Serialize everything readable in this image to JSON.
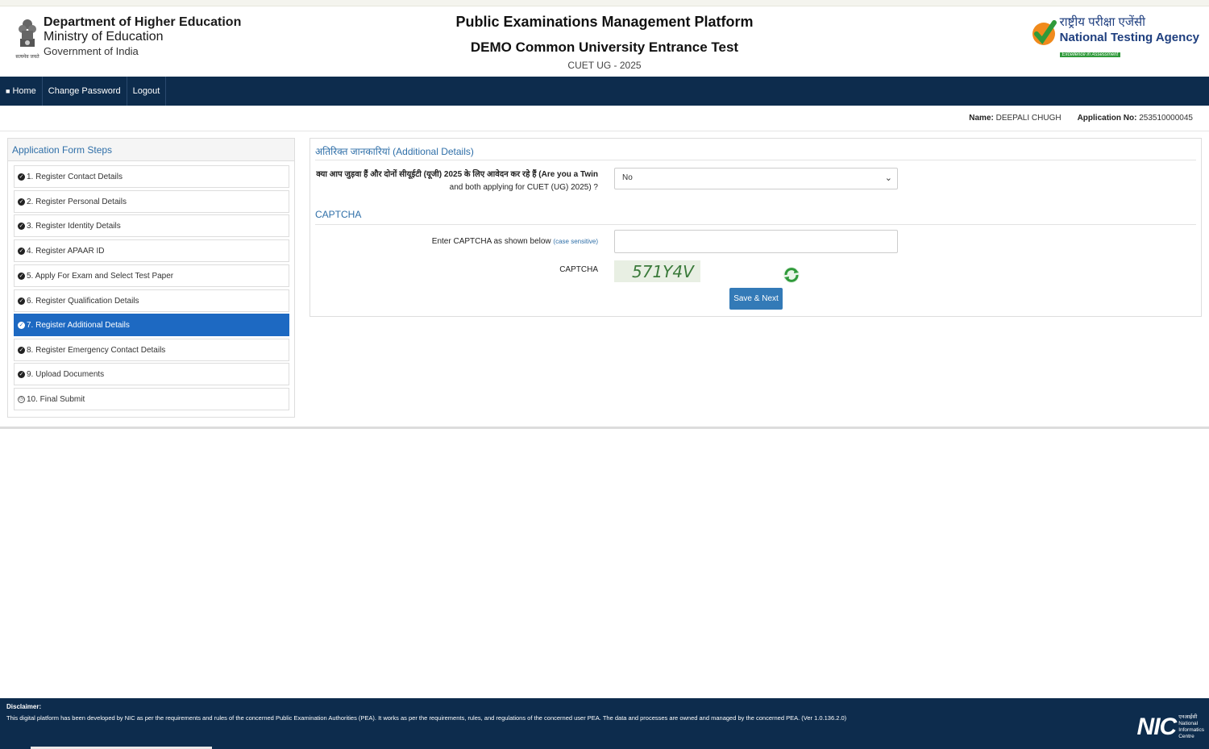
{
  "header": {
    "dept_line1": "Department of Higher Education",
    "dept_line2": "Ministry of Education",
    "dept_line3": "Government of India",
    "emblem_text": "सत्यमेव जयते",
    "title": "Public Examinations Management Platform",
    "subtitle": "DEMO Common University Entrance Test",
    "exam": "CUET UG - 2025",
    "nta_hindi": "राष्ट्रीय परीक्षा एजेंसी",
    "nta_english": "National Testing Agency",
    "nta_tagline": "Excellence in Assessment"
  },
  "nav": {
    "home": "Home",
    "change_password": "Change Password",
    "logout": "Logout"
  },
  "user": {
    "name_label": "Name:",
    "name_value": "DEEPALI CHUGH",
    "app_label": "Application No:",
    "app_value": "253510000045"
  },
  "steps": {
    "title": "Application Form Steps",
    "items": [
      {
        "label": "1. Register Contact Details",
        "status": "done"
      },
      {
        "label": "2. Register Personal Details",
        "status": "done"
      },
      {
        "label": "3. Register Identity Details",
        "status": "done"
      },
      {
        "label": "4. Register APAAR ID",
        "status": "done"
      },
      {
        "label": "5. Apply For Exam and Select Test Paper",
        "status": "done"
      },
      {
        "label": "6. Register Qualification Details",
        "status": "done"
      },
      {
        "label": "7. Register Additional Details",
        "status": "active"
      },
      {
        "label": "8. Register Emergency Contact Details",
        "status": "done"
      },
      {
        "label": "9. Upload Documents",
        "status": "done"
      },
      {
        "label": "10. Final Submit",
        "status": "pending"
      }
    ]
  },
  "form": {
    "section_title": "अतिरिक्त जानकारियां (Additional Details)",
    "twin_question_line1": "क्या आप जुड़वा हैं और दोनों सीयूईटी (यूजी) 2025 के लिए आवेदन कर रहे हैं (Are you a Twin",
    "twin_question_line2": "and both applying for CUET (UG) 2025) ?",
    "twin_value": "No",
    "captcha_section": "CAPTCHA",
    "captcha_prompt": "Enter CAPTCHA as shown below",
    "captcha_hint": "(case sensitive)",
    "captcha_input_value": "",
    "captcha_label": "CAPTCHA",
    "captcha_text": "571Y4V",
    "save_button": "Save & Next"
  },
  "footer": {
    "disclaimer_title": "Disclaimer:",
    "disclaimer_text": "This digital platform has been developed by NIC as per the requirements and rules of the concerned Public Examination Authorities (PEA). It works as per the requirements, rules, and regulations of the concerned user PEA. The data and processes are owned and managed by the concerned PEA. (Ver 1.0.136.2.0)",
    "nic_logo": "NIC",
    "nic_hindi": "एनआईसी",
    "nic_line1": "National",
    "nic_line2": "Informatics",
    "nic_line3": "Centre"
  },
  "colors": {
    "navbar": "#0d2c4d",
    "active_step": "#1d69c2",
    "button": "#337ab7",
    "section_title": "#2f6fa8"
  }
}
